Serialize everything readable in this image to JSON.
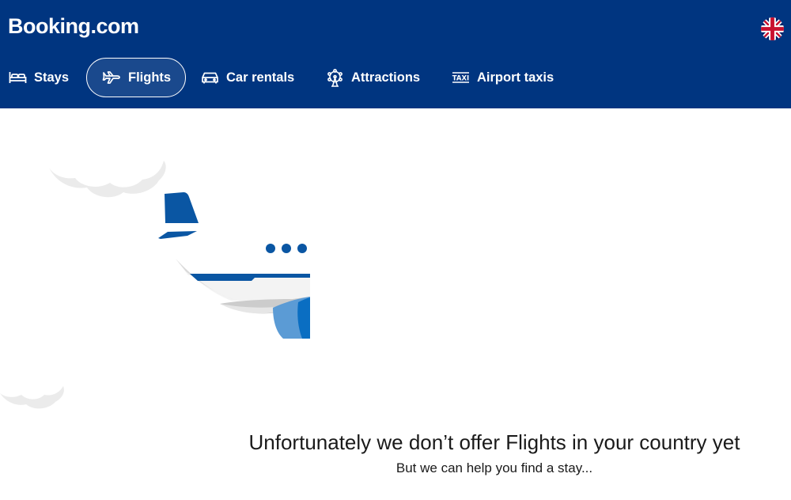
{
  "header": {
    "logo_text": "Booking.com",
    "background_color": "#003580",
    "language_flag_icon": "uk-flag-icon"
  },
  "nav": {
    "items": [
      {
        "label": "Stays",
        "icon": "bed-icon",
        "active": false
      },
      {
        "label": "Flights",
        "icon": "plane-icon",
        "active": true
      },
      {
        "label": "Car rentals",
        "icon": "car-icon",
        "active": false
      },
      {
        "label": "Attractions",
        "icon": "ferris-wheel-icon",
        "active": false
      },
      {
        "label": "Airport taxis",
        "icon": "taxi-icon",
        "active": false
      }
    ]
  },
  "main": {
    "title": "Unfortunately we don’t offer Flights in your country yet",
    "subtitle": "But we can help you find a stay..."
  },
  "colors": {
    "brand_dark": "#003580",
    "plane_blue": "#0a56a3",
    "plane_light_blue": "#5b9bd5",
    "cloud_gray": "#ebebeb"
  }
}
